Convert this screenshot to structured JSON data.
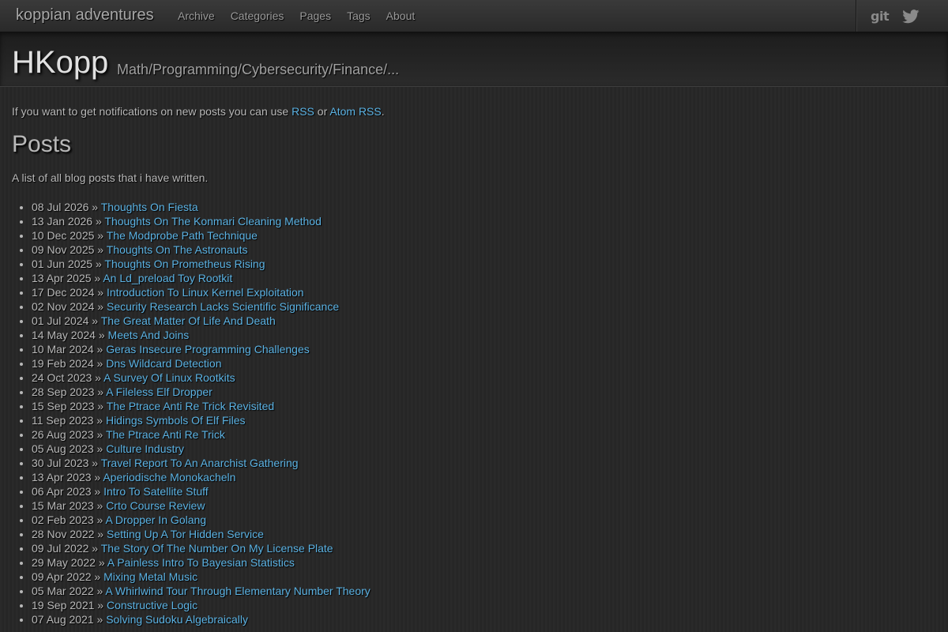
{
  "nav": {
    "brand": "koppian adventures",
    "links": [
      "Archive",
      "Categories",
      "Pages",
      "Tags",
      "About"
    ],
    "git_label": "git",
    "twitter_icon": "twitter-icon"
  },
  "header": {
    "title": "HKopp",
    "subtitle": "Math/Programming/Cybersecurity/Finance/..."
  },
  "notify": {
    "prefix": "If you want to get notifications on new posts you can use",
    "rss_link": "RSS",
    "or": "or",
    "atom_link": "Atom RSS",
    "suffix": "."
  },
  "posts": {
    "heading": "Posts",
    "description": "A list of all blog posts that i have written.",
    "separator": "»",
    "items": [
      {
        "date": "08 Jul 2026",
        "title": "Thoughts On Fiesta"
      },
      {
        "date": "13 Jan 2026",
        "title": "Thoughts On The Konmari Cleaning Method"
      },
      {
        "date": "10 Dec 2025",
        "title": "The Modprobe Path Technique"
      },
      {
        "date": "09 Nov 2025",
        "title": "Thoughts On The Astronauts"
      },
      {
        "date": "01 Jun 2025",
        "title": "Thoughts On Prometheus Rising"
      },
      {
        "date": "13 Apr 2025",
        "title": "An Ld_preload Toy Rootkit"
      },
      {
        "date": "17 Dec 2024",
        "title": "Introduction To Linux Kernel Exploitation"
      },
      {
        "date": "02 Nov 2024",
        "title": "Security Research Lacks Scientific Significance"
      },
      {
        "date": "01 Jul 2024",
        "title": "The Great Matter Of Life And Death"
      },
      {
        "date": "14 May 2024",
        "title": "Meets And Joins"
      },
      {
        "date": "10 Mar 2024",
        "title": "Geras Insecure Programming Challenges"
      },
      {
        "date": "19 Feb 2024",
        "title": "Dns Wildcard Detection"
      },
      {
        "date": "24 Oct 2023",
        "title": "A Survey Of Linux Rootkits"
      },
      {
        "date": "28 Sep 2023",
        "title": "A Fileless Elf Dropper"
      },
      {
        "date": "15 Sep 2023",
        "title": "The Ptrace Anti Re Trick Revisited"
      },
      {
        "date": "11 Sep 2023",
        "title": "Hidings Symbols Of Elf Files"
      },
      {
        "date": "26 Aug 2023",
        "title": "The Ptrace Anti Re Trick"
      },
      {
        "date": "05 Aug 2023",
        "title": "Culture Industry"
      },
      {
        "date": "30 Jul 2023",
        "title": "Travel Report To An Anarchist Gathering"
      },
      {
        "date": "13 Apr 2023",
        "title": "Aperiodische Monokacheln"
      },
      {
        "date": "06 Apr 2023",
        "title": "Intro To Satellite Stuff"
      },
      {
        "date": "15 Mar 2023",
        "title": "Crto Course Review"
      },
      {
        "date": "02 Feb 2023",
        "title": "A Dropper In Golang"
      },
      {
        "date": "28 Nov 2022",
        "title": "Setting Up A Tor Hidden Service"
      },
      {
        "date": "09 Jul 2022",
        "title": "The Story Of The Number On My License Plate"
      },
      {
        "date": "29 May 2022",
        "title": "A Painless Intro To Bayesian Statistics"
      },
      {
        "date": "09 Apr 2022",
        "title": "Mixing Metal Music"
      },
      {
        "date": "05 Mar 2022",
        "title": "A Whirlwind Tour Through Elementary Number Theory"
      },
      {
        "date": "19 Sep 2021",
        "title": "Constructive Logic"
      },
      {
        "date": "07 Aug 2021",
        "title": "Solving Sudoku Algebraically"
      }
    ]
  },
  "colors": {
    "link": "#5bb2e3",
    "text": "#b8b8b8",
    "background": "#272727"
  }
}
